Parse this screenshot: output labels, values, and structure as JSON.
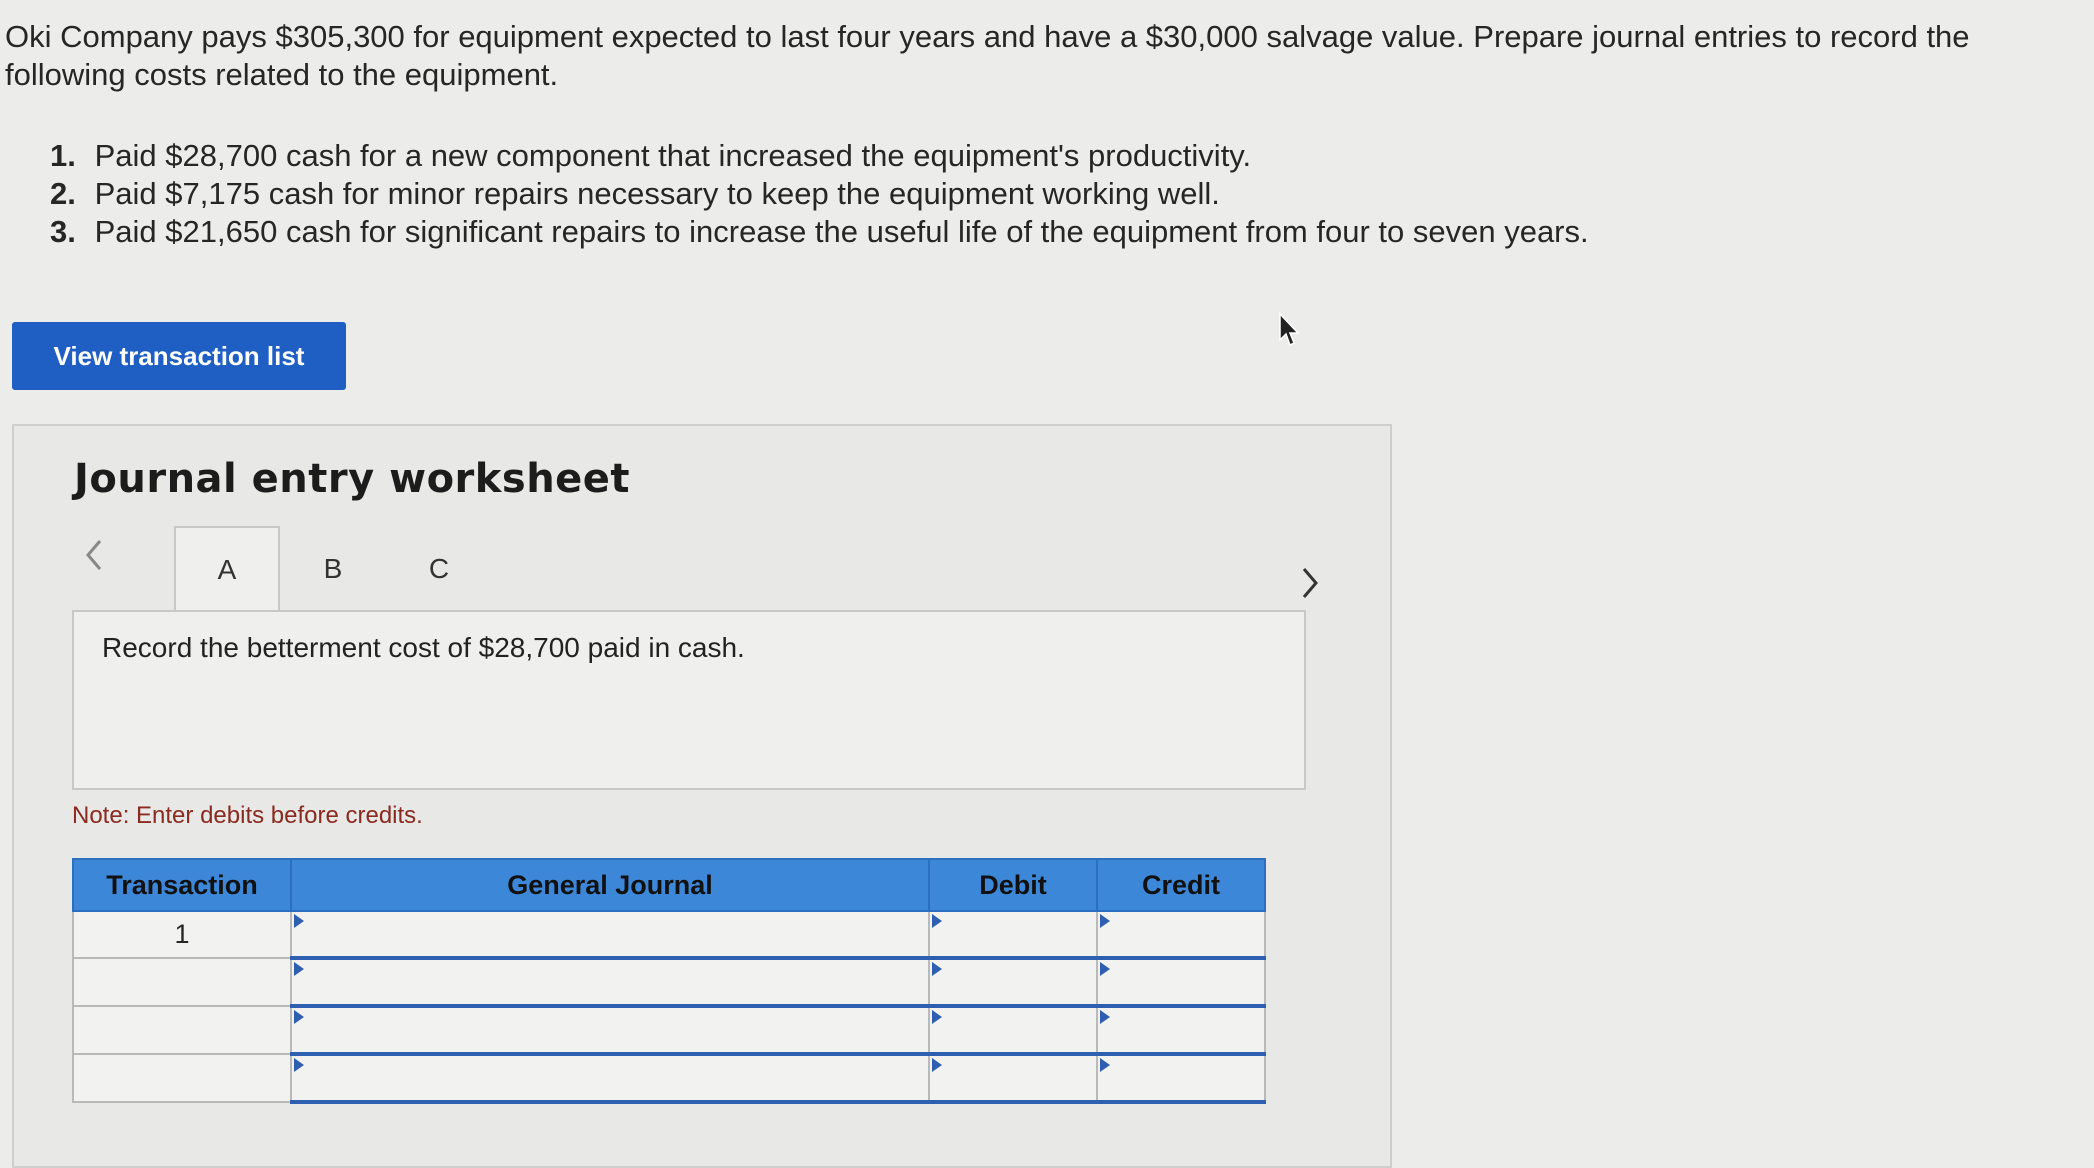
{
  "problem": {
    "intro": "Oki Company pays $305,300 for equipment expected to last four years and have a $30,000 salvage value. Prepare journal entries to record the following costs related to the equipment.",
    "items": [
      {
        "num": "1.",
        "text": "Paid $28,700 cash for a new component that increased the equipment's productivity."
      },
      {
        "num": "2.",
        "text": "Paid $7,175 cash for minor repairs necessary to keep the equipment working well."
      },
      {
        "num": "3.",
        "text": "Paid $21,650 cash for significant repairs to increase the useful life of the equipment from four to seven years."
      }
    ]
  },
  "actions": {
    "view_transactions": "View transaction list"
  },
  "worksheet": {
    "title": "Journal entry worksheet",
    "tabs": [
      "A",
      "B",
      "C"
    ],
    "active_tab": "A",
    "instruction": "Record the betterment cost of $28,700 paid in cash.",
    "note": "Note: Enter debits before credits."
  },
  "journal": {
    "headers": {
      "transaction": "Transaction",
      "general_journal": "General Journal",
      "debit": "Debit",
      "credit": "Credit"
    },
    "rows": [
      {
        "transaction": "1",
        "account": "",
        "debit": "",
        "credit": ""
      },
      {
        "transaction": "",
        "account": "",
        "debit": "",
        "credit": ""
      },
      {
        "transaction": "",
        "account": "",
        "debit": "",
        "credit": ""
      },
      {
        "transaction": "",
        "account": "",
        "debit": "",
        "credit": ""
      }
    ]
  },
  "colors": {
    "button": "#1f5fc4",
    "table_header": "#3d87d9",
    "note": "#8a2a20"
  }
}
